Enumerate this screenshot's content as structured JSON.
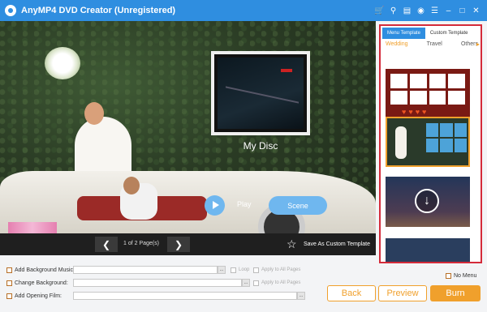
{
  "app": {
    "title": "AnyMP4 DVD Creator (Unregistered)"
  },
  "title_icons": [
    "cart-icon",
    "key-icon",
    "document-icon",
    "chat-icon",
    "menu-icon",
    "minimize-icon",
    "maximize-icon",
    "close-icon"
  ],
  "preview": {
    "disc_title": "My Disc",
    "play_label": "Play",
    "scene_label": "Scene"
  },
  "pager": {
    "page_info": "1 of 2 Page(s)",
    "save_custom": "Save As Custom Template"
  },
  "panel": {
    "tabs": [
      "Menu Template",
      "Custom Template"
    ],
    "subtabs": [
      "Wedding",
      "Travel",
      "Others"
    ],
    "active_subtab": "Wedding"
  },
  "options": {
    "bg_music": "Add Background Music:",
    "loop": "Loop",
    "apply_all_1": "Apply to All Pages",
    "change_bg": "Change Background:",
    "apply_all_2": "Apply to All Pages",
    "opening_film": "Add Opening Film:",
    "no_menu": "No Menu",
    "browse": "..."
  },
  "buttons": {
    "back": "Back",
    "preview": "Preview",
    "burn": "Burn"
  },
  "colors": {
    "accent": "#2f8ee0",
    "orange": "#f0a02c",
    "highlight_border": "#d42b3a"
  }
}
